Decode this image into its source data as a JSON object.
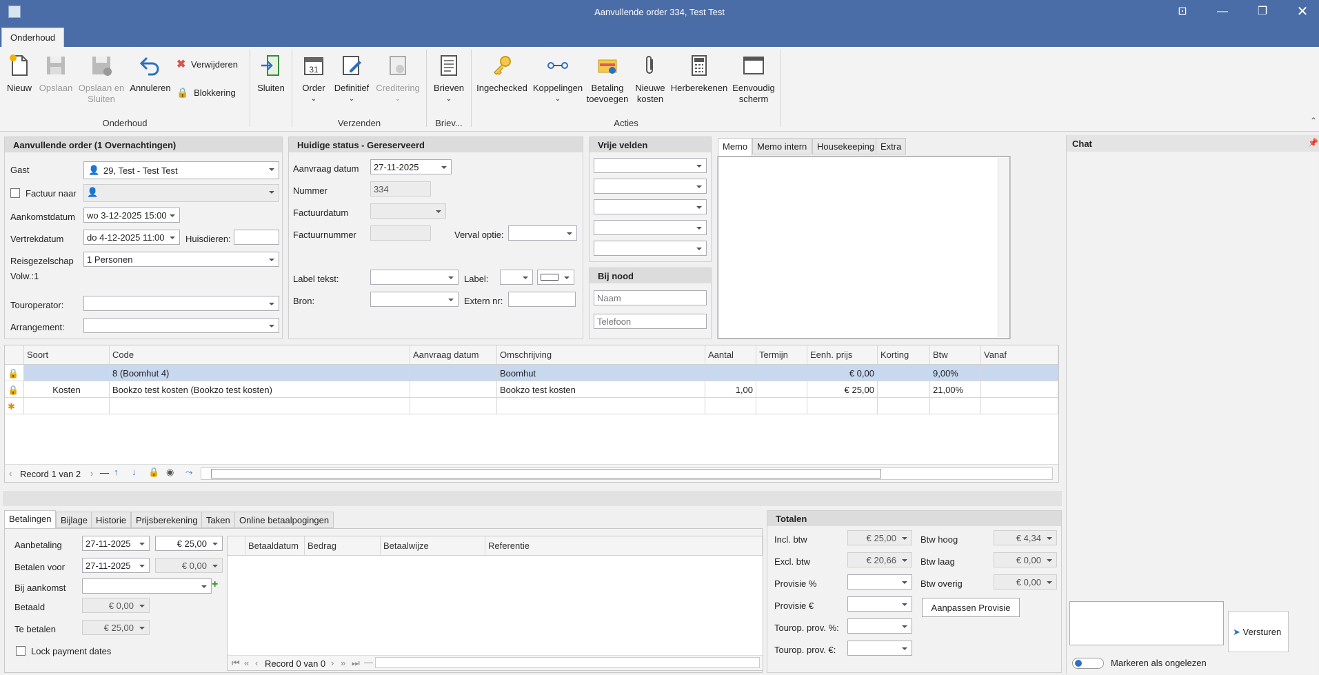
{
  "window": {
    "title": "Aanvullende order 334, Test Test"
  },
  "tabs": {
    "active": "Onderhoud"
  },
  "ribbon": {
    "nieuw": "Nieuw",
    "opslaan": "Opslaan",
    "opslaan_sluiten": "Opslaan en Sluiten",
    "annuleren": "Annuleren",
    "verwijderen": "Verwijderen",
    "blokkering": "Blokkering",
    "sluiten": "Sluiten",
    "order": "Order",
    "definitief": "Definitief",
    "crediteren": "Creditering",
    "brieven": "Brieven",
    "ingechecked": "Ingechecked",
    "koppelingen": "Koppelingen",
    "betaling_toevoegen": "Betaling toevoegen",
    "nieuwe_kosten": "Nieuwe kosten",
    "herberekenen": "Herberekenen",
    "eenvoudig": "Eenvoudig scherm",
    "groups": {
      "onderhoud": "Onderhoud",
      "verzenden": "Verzenden",
      "brieven": "Briev...",
      "acties": "Acties"
    }
  },
  "order": {
    "header": "Aanvullende order (1 Overnachtingen)",
    "gast_label": "Gast",
    "gast": "29, Test - Test Test",
    "factuur_label": "Factuur naar",
    "aankomst_label": "Aankomstdatum",
    "aankomst": "wo 3-12-2025 15:00",
    "vertrek_label": "Vertrekdatum",
    "vertrek": "do 4-12-2025 11:00",
    "huisdieren_label": "Huisdieren:",
    "reis_label": "Reisgezelschap",
    "reis": "1 Personen",
    "volw": "Volw.:1",
    "touroperator_label": "Touroperator:",
    "arrangement_label": "Arrangement:"
  },
  "status": {
    "header": "Huidige status - Gereserveerd",
    "aanvraag_label": "Aanvraag datum",
    "aanvraag": "27-11-2025",
    "nummer_label": "Nummer",
    "nummer": "334",
    "factuurdatum_label": "Factuurdatum",
    "factuurnummer_label": "Factuurnummer",
    "verval_label": "Verval optie:",
    "labeltekst_label": "Label tekst:",
    "label_label": "Label:",
    "bron_label": "Bron:",
    "extern_label": "Extern nr:"
  },
  "vrije": {
    "header": "Vrije velden"
  },
  "nood": {
    "header": "Bij nood",
    "naam_ph": "Naam",
    "telefoon_ph": "Telefoon"
  },
  "memo": {
    "tabs": [
      "Memo",
      "Memo intern",
      "Housekeeping",
      "Extra"
    ]
  },
  "chat": {
    "header": "Chat",
    "send": "Versturen",
    "unread": "Markeren als ongelezen"
  },
  "grid": {
    "columns": [
      "Soort",
      "Code",
      "Aanvraag datum",
      "Omschrijving",
      "Aantal",
      "Termijn",
      "Eenh. prijs",
      "Korting",
      "Btw",
      "Vanaf"
    ],
    "rows": [
      {
        "soort": "",
        "code": "8 (Boomhut 4)",
        "aanvraag": "",
        "omschrijving": "Boomhut",
        "aantal": "",
        "termijn": "",
        "prijs": "€ 0,00",
        "korting": "",
        "btw": "9,00%"
      },
      {
        "soort": "Kosten",
        "code": "Bookzo test kosten (Bookzo test kosten)",
        "aanvraag": "",
        "omschrijving": "Bookzo test kosten",
        "aantal": "1,00",
        "termijn": "",
        "prijs": "€ 25,00",
        "korting": "",
        "btw": "21,00%"
      }
    ],
    "record": "Record 1 van 2"
  },
  "bottom_tabs": [
    "Betalingen",
    "Bijlage",
    "Historie",
    "Prijsberekening",
    "Taken",
    "Online betaalpogingen"
  ],
  "pay": {
    "aanbetaling_label": "Aanbetaling",
    "aanbetaling_date": "27-11-2025",
    "aanbetaling_amt": "€ 25,00",
    "betalen_label": "Betalen voor",
    "betalen_date": "27-11-2025",
    "betalen_amt": "€ 0,00",
    "bij_label": "Bij aankomst",
    "betaald_label": "Betaald",
    "betaald": "€ 0,00",
    "te_label": "Te betalen",
    "te": "€ 25,00",
    "lock_label": "Lock payment dates",
    "cols": [
      "Betaaldatum",
      "Bedrag",
      "Betaalwijze",
      "Referentie"
    ],
    "record": "Record 0 van 0"
  },
  "totals": {
    "header": "Totalen",
    "incl_label": "Incl. btw",
    "incl": "€ 25,00",
    "excl_label": "Excl. btw",
    "excl": "€ 20,66",
    "prov_pct_label": "Provisie %",
    "prov_eur_label": "Provisie €",
    "tour_pct_label": "Tourop. prov. %:",
    "tour_eur_label": "Tourop. prov. €:",
    "hoog_label": "Btw hoog",
    "hoog": "€ 4,34",
    "laag_label": "Btw laag",
    "laag": "€ 0,00",
    "overig_label": "Btw overig",
    "overig": "€ 0,00",
    "aanpassen": "Aanpassen Provisie"
  }
}
